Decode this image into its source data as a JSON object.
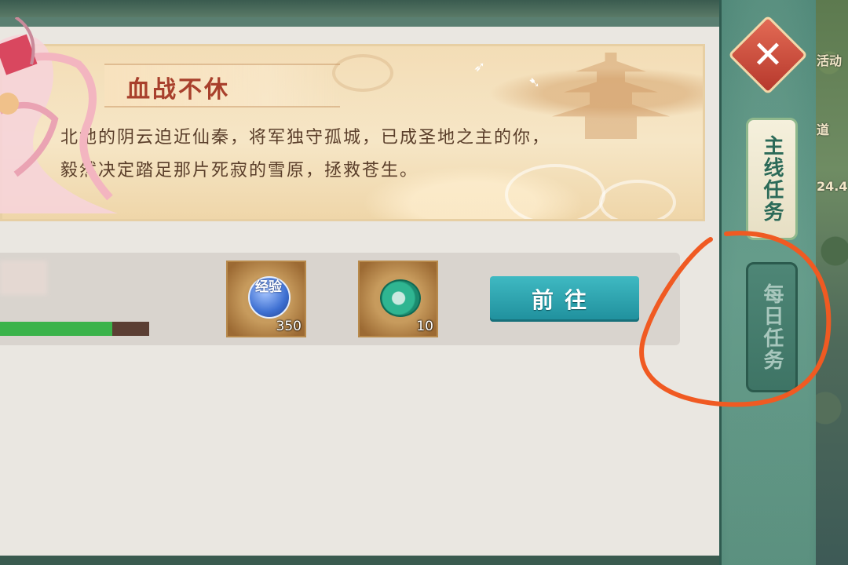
{
  "banner": {
    "title": "血战不休",
    "desc_line1": "北地的阴云迫近仙秦，将军独守孤城，已成圣地之主的你，",
    "desc_line2": "毅然决定踏足那片死寂的雪原，拯救苍生。"
  },
  "task": {
    "progress_fraction": 0.75,
    "rewards": [
      {
        "icon": "exp-orb-icon",
        "label": "经验",
        "count": "350"
      },
      {
        "icon": "jade-icon",
        "count": "10"
      }
    ],
    "go_button": "前往"
  },
  "tabs": {
    "main": "主线任务",
    "daily": "每日任务"
  },
  "world": {
    "text1": "活动",
    "text2": "道",
    "text3": "24.4"
  },
  "colors": {
    "accent_teal": "#2aa4ae",
    "title_red": "#a8402c",
    "progress_green": "#3bb34a",
    "annotation_orange": "#f05a22"
  }
}
